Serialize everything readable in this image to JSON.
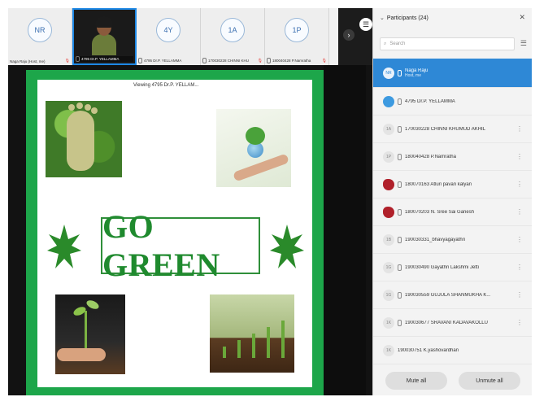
{
  "strip": {
    "tiles": [
      {
        "initials": "NR",
        "name": "Naga Raju (Host, me)"
      },
      {
        "initials": "",
        "name": "4795 Dr.P. YELLAMMA"
      },
      {
        "initials": "4Y",
        "name": "4795 Dr.P. YELLAMMA"
      },
      {
        "initials": "1A",
        "name": "170030228 CHINNI KHU"
      },
      {
        "initials": "1P",
        "name": "180040428 P.Namratha"
      }
    ]
  },
  "share": {
    "viewing": "Viewing 4795 Dr.P. YELLAM...",
    "title": "GO GREEN"
  },
  "panel": {
    "title": "Participants (24)",
    "search_placeholder": "Search",
    "participants": [
      {
        "initials": "NR",
        "name": "Naga Raju",
        "sub": "Host, me"
      },
      {
        "initials": "",
        "name": "4795 Dr.P. YELLAMMA"
      },
      {
        "initials": "1A",
        "name": "170030228 CHINNI KHUMUD AKHIL"
      },
      {
        "initials": "1P",
        "name": "180040428 P.Namratha"
      },
      {
        "initials": "",
        "name": "180070163 Atluri pavan kalyan"
      },
      {
        "initials": "",
        "name": "180070203 N. Sree Sai Ganesh"
      },
      {
        "initials": "1B",
        "name": "190030331_bhavyagayathri"
      },
      {
        "initials": "1G",
        "name": "190030490 Gayathri Lakshmi Jetti"
      },
      {
        "initials": "1G",
        "name": "190030559 GUJULA SHANMUKHA K..."
      },
      {
        "initials": "1K",
        "name": "190030677 SRAVANI KADAVAKOLLU"
      },
      {
        "initials": "1K",
        "name": "190030751 K.yashovardhan"
      }
    ],
    "mute_all": "Mute all",
    "unmute_all": "Unmute all"
  },
  "colors": {
    "accent": "#2e88d6",
    "slide_border": "#1da64a",
    "title": "#1f8a2e"
  }
}
